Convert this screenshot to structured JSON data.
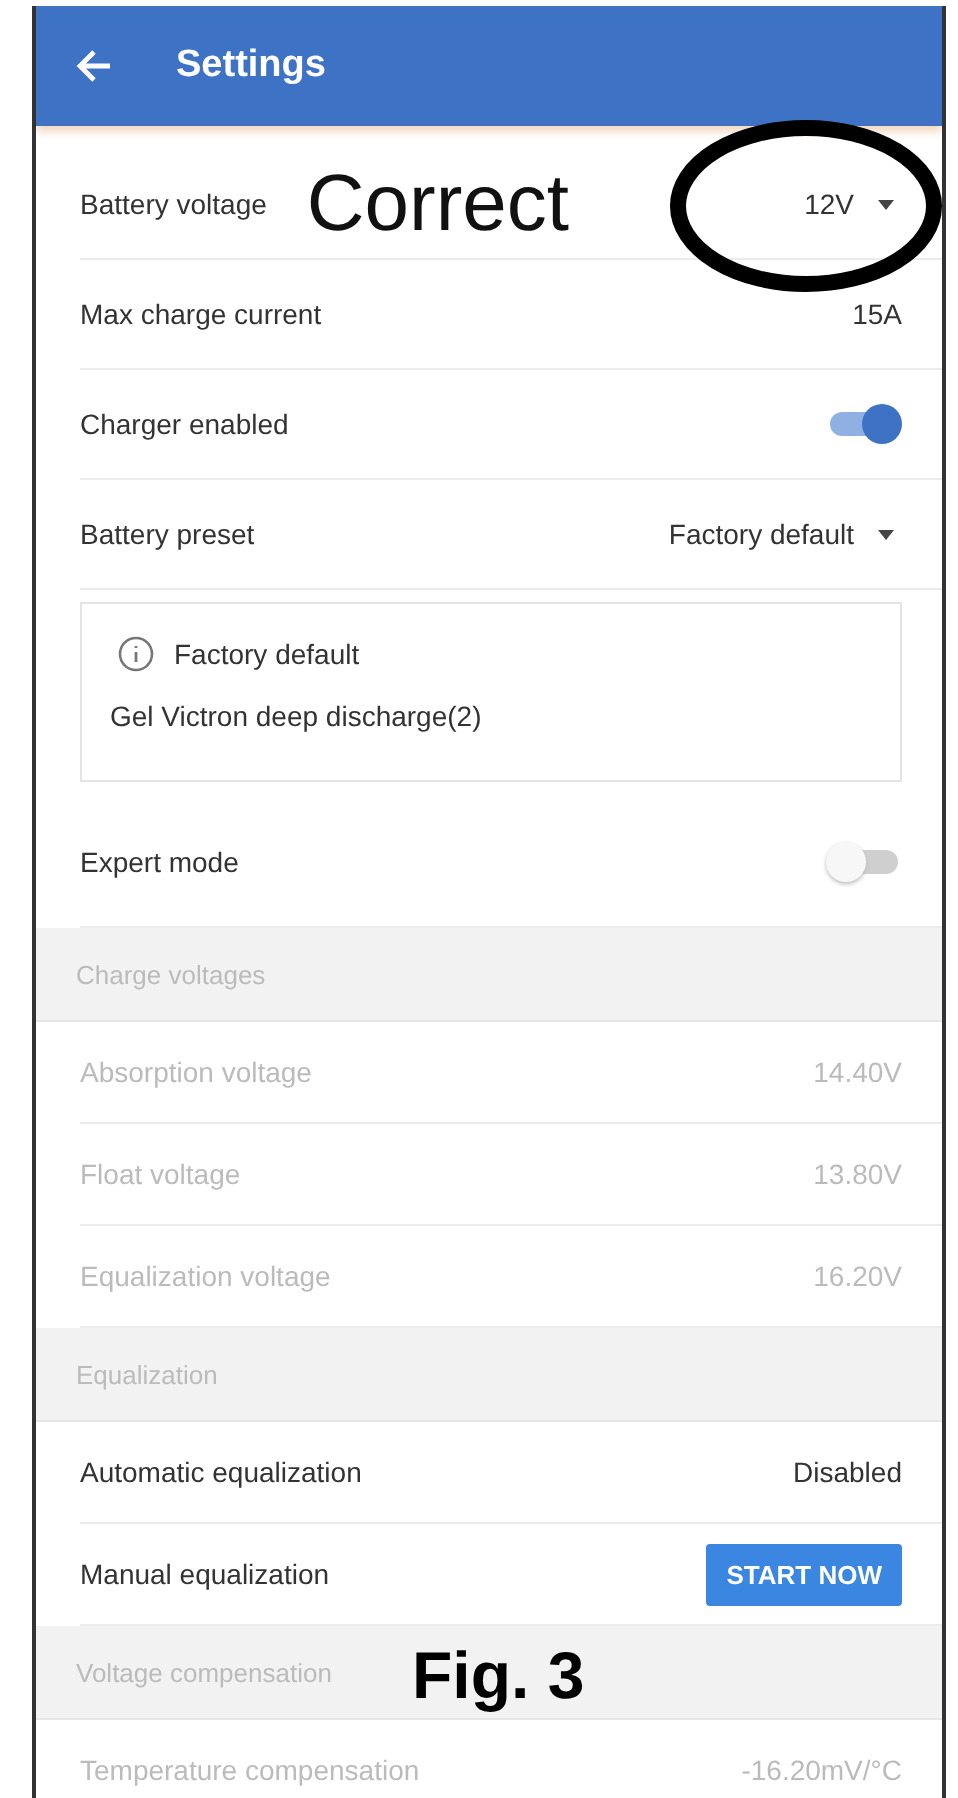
{
  "header": {
    "title": "Settings"
  },
  "rows": [
    {
      "kind": "dropdown",
      "label": "Battery voltage",
      "value": "12V",
      "annotation": "Correct",
      "circled": true
    },
    {
      "kind": "value",
      "label": "Max charge current",
      "value": "15A",
      "disabled": false
    },
    {
      "kind": "toggle",
      "label": "Charger enabled",
      "on": true
    },
    {
      "kind": "dropdown",
      "label": "Battery preset",
      "value": "Factory default"
    },
    {
      "kind": "info",
      "title": "Factory default",
      "text": "Gel Victron deep discharge(2)"
    },
    {
      "kind": "toggle",
      "label": "Expert mode",
      "on": false
    },
    {
      "kind": "section",
      "label": "Charge voltages"
    },
    {
      "kind": "value",
      "label": "Absorption voltage",
      "value": "14.40V",
      "disabled": true
    },
    {
      "kind": "value",
      "label": "Float voltage",
      "value": "13.80V",
      "disabled": true
    },
    {
      "kind": "value",
      "label": "Equalization voltage",
      "value": "16.20V",
      "disabled": true
    },
    {
      "kind": "section",
      "label": "Equalization"
    },
    {
      "kind": "value",
      "label": "Automatic equalization",
      "value": "Disabled",
      "disabled": false
    },
    {
      "kind": "button",
      "label": "Manual equalization",
      "button": "START NOW"
    },
    {
      "kind": "section",
      "label": "Voltage compensation"
    },
    {
      "kind": "value",
      "label": "Temperature compensation",
      "value": "-16.20mV/°C",
      "disabled": true
    }
  ],
  "caption": "Fig. 3"
}
